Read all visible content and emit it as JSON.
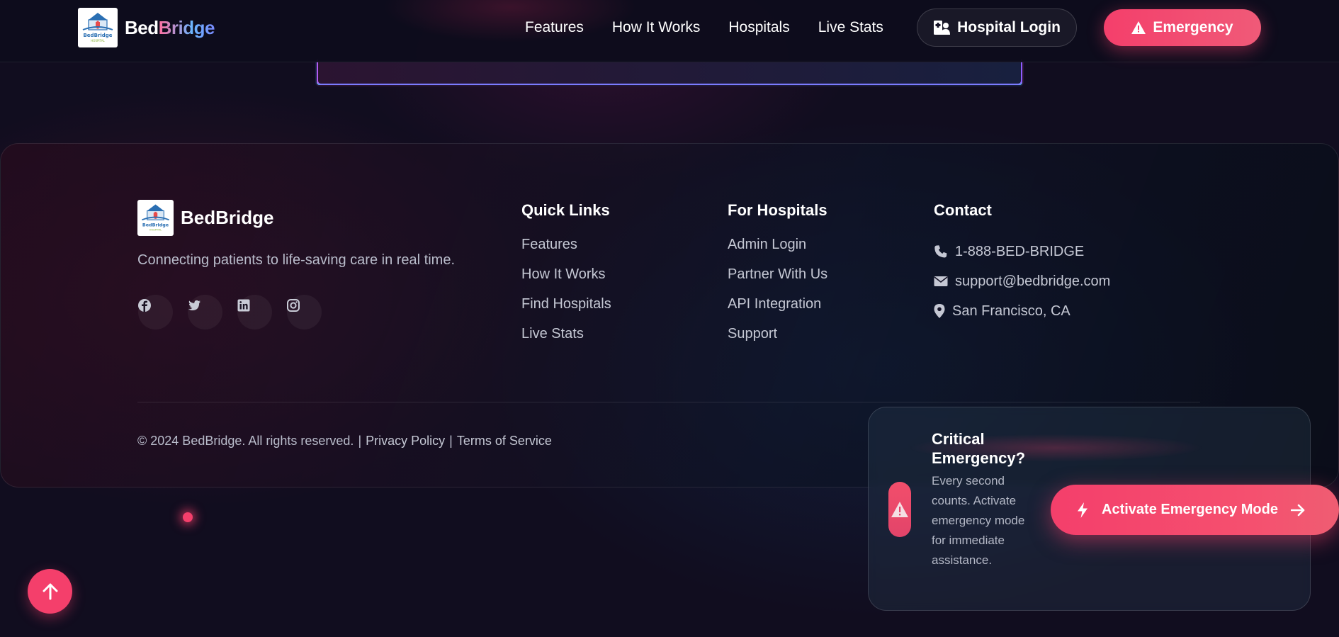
{
  "brand": {
    "name_part1": "Bed",
    "name_part2": "Bridge",
    "full_name": "BedBridge"
  },
  "nav": {
    "links": [
      "Features",
      "How It Works",
      "Hospitals",
      "Live Stats"
    ],
    "login_label": "Hospital Login",
    "emergency_label": "Emergency"
  },
  "footer": {
    "brand_name": "BedBridge",
    "tagline": "Connecting patients to life-saving care in real time.",
    "socials": [
      "facebook-icon",
      "twitter-icon",
      "linkedin-icon",
      "instagram-icon"
    ],
    "quick_links": {
      "title": "Quick Links",
      "items": [
        "Features",
        "How It Works",
        "Find Hospitals",
        "Live Stats"
      ]
    },
    "for_hospitals": {
      "title": "For Hospitals",
      "items": [
        "Admin Login",
        "Partner With Us",
        "API Integration",
        "Support"
      ]
    },
    "contact": {
      "title": "Contact",
      "phone": "1-888-BED-BRIDGE",
      "email": "support@bedbridge.com",
      "location": "San Francisco, CA"
    },
    "copyright": "© 2024 BedBridge. All rights reserved.",
    "sep": "|",
    "privacy": "Privacy Policy",
    "terms": "Terms of Service"
  },
  "critical": {
    "title": "Critical Emergency?",
    "description": "Every second counts. Activate emergency mode for immediate assistance.",
    "button_label": "Activate Emergency Mode"
  },
  "colors": {
    "accent": "#f43f6b",
    "background": "#110d1f",
    "muted_text": "#c5c8d4"
  }
}
